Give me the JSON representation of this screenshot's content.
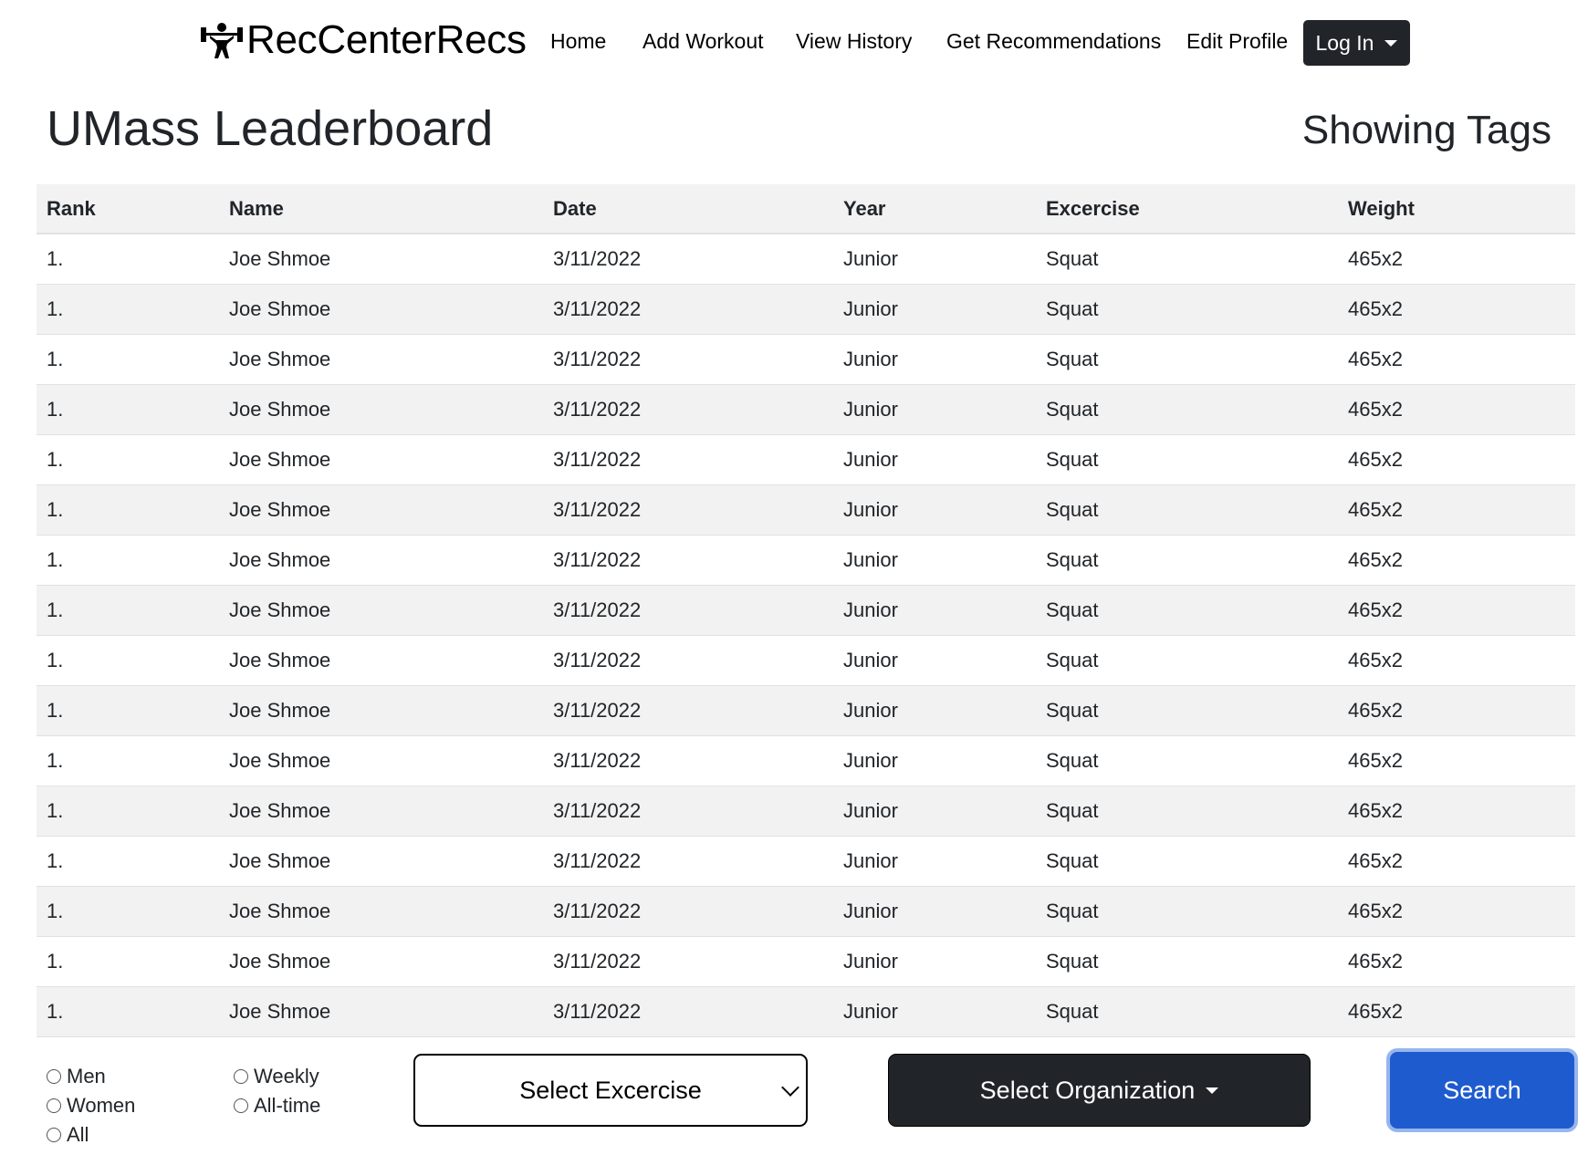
{
  "brand": {
    "name": "RecCenterRecs",
    "icon": "weightlifter-icon"
  },
  "nav": {
    "home": "Home",
    "add_workout": "Add Workout",
    "view_history": "View History",
    "get_recommendations": "Get Recommendations",
    "edit_profile": "Edit Profile",
    "login": "Log In"
  },
  "page": {
    "title": "UMass Leaderboard",
    "tags_heading": "Showing Tags"
  },
  "table": {
    "headers": [
      "Rank",
      "Name",
      "Date",
      "Year",
      "Excercise",
      "Weight"
    ],
    "rows": [
      [
        "1.",
        "Joe Shmoe",
        "3/11/2022",
        "Junior",
        "Squat",
        "465x2"
      ],
      [
        "1.",
        "Joe Shmoe",
        "3/11/2022",
        "Junior",
        "Squat",
        "465x2"
      ],
      [
        "1.",
        "Joe Shmoe",
        "3/11/2022",
        "Junior",
        "Squat",
        "465x2"
      ],
      [
        "1.",
        "Joe Shmoe",
        "3/11/2022",
        "Junior",
        "Squat",
        "465x2"
      ],
      [
        "1.",
        "Joe Shmoe",
        "3/11/2022",
        "Junior",
        "Squat",
        "465x2"
      ],
      [
        "1.",
        "Joe Shmoe",
        "3/11/2022",
        "Junior",
        "Squat",
        "465x2"
      ],
      [
        "1.",
        "Joe Shmoe",
        "3/11/2022",
        "Junior",
        "Squat",
        "465x2"
      ],
      [
        "1.",
        "Joe Shmoe",
        "3/11/2022",
        "Junior",
        "Squat",
        "465x2"
      ],
      [
        "1.",
        "Joe Shmoe",
        "3/11/2022",
        "Junior",
        "Squat",
        "465x2"
      ],
      [
        "1.",
        "Joe Shmoe",
        "3/11/2022",
        "Junior",
        "Squat",
        "465x2"
      ],
      [
        "1.",
        "Joe Shmoe",
        "3/11/2022",
        "Junior",
        "Squat",
        "465x2"
      ],
      [
        "1.",
        "Joe Shmoe",
        "3/11/2022",
        "Junior",
        "Squat",
        "465x2"
      ],
      [
        "1.",
        "Joe Shmoe",
        "3/11/2022",
        "Junior",
        "Squat",
        "465x2"
      ],
      [
        "1.",
        "Joe Shmoe",
        "3/11/2022",
        "Junior",
        "Squat",
        "465x2"
      ],
      [
        "1.",
        "Joe Shmoe",
        "3/11/2022",
        "Junior",
        "Squat",
        "465x2"
      ],
      [
        "1.",
        "Joe Shmoe",
        "3/11/2022",
        "Junior",
        "Squat",
        "465x2"
      ]
    ]
  },
  "filters": {
    "gender": {
      "men": "Men",
      "women": "Women",
      "all": "All"
    },
    "period": {
      "weekly": "Weekly",
      "alltime": "All-time"
    },
    "exercise_select": "Select Excercise",
    "organization": "Select Organization",
    "search": "Search"
  },
  "colors": {
    "dark": "#212529",
    "primary": "#1e5bcf",
    "stripe": "#f2f2f2"
  }
}
